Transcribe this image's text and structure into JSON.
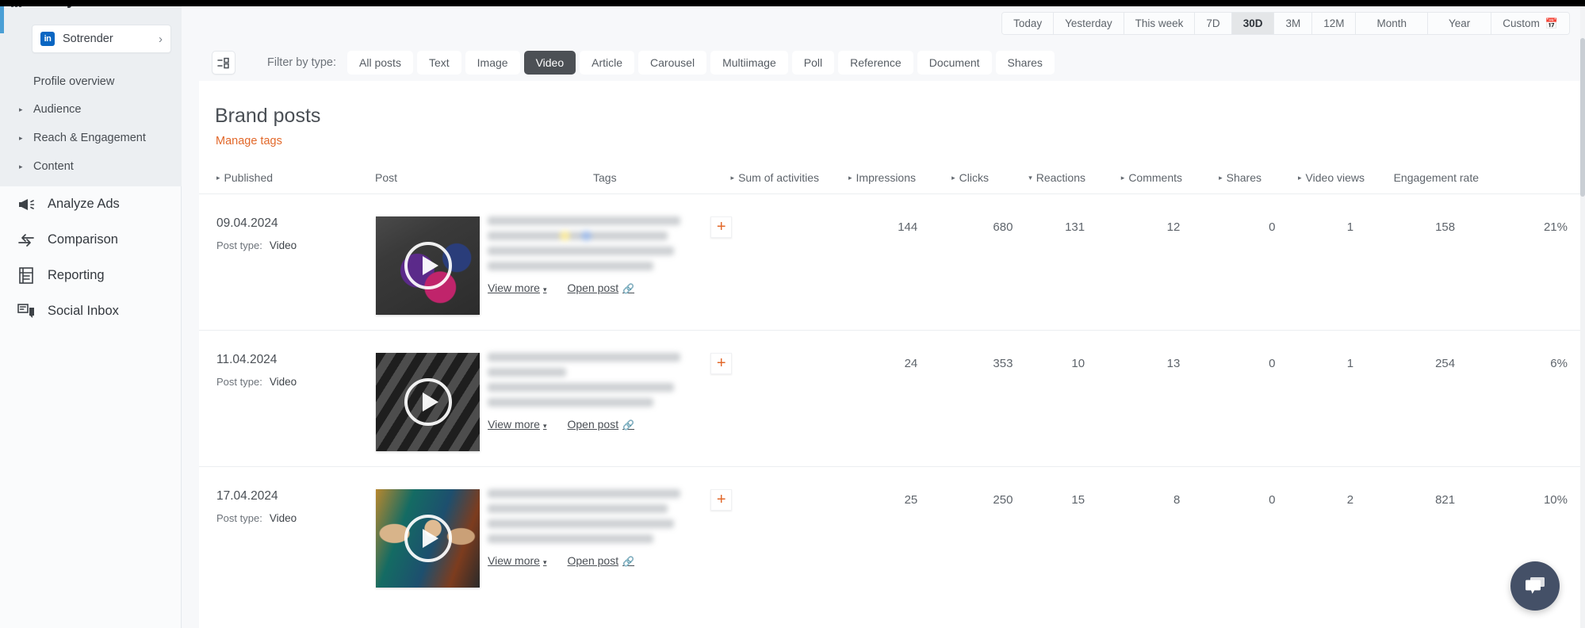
{
  "sidebar": {
    "section_title": "Analytics",
    "section_icon": "bar-chart-icon",
    "profile": {
      "network_badge": "in",
      "name": "Sotrender",
      "chevron": "›"
    },
    "sub_items": [
      {
        "label": "Profile overview",
        "expandable": false
      },
      {
        "label": "Audience",
        "expandable": true
      },
      {
        "label": "Reach & Engagement",
        "expandable": true
      },
      {
        "label": "Content",
        "expandable": true
      }
    ],
    "main_items": [
      {
        "label": "Analyze Ads",
        "icon": "megaphone-icon"
      },
      {
        "label": "Comparison",
        "icon": "compare-arrows-icon"
      },
      {
        "label": "Reporting",
        "icon": "document-report-icon"
      },
      {
        "label": "Social Inbox",
        "icon": "chat-inbox-icon"
      }
    ]
  },
  "date_range": {
    "options": [
      "Today",
      "Yesterday",
      "This week",
      "7D",
      "30D",
      "3M",
      "12M",
      "Month",
      "Year",
      "Custom"
    ],
    "selected": "30D",
    "custom_icon": "calendar-icon"
  },
  "filter": {
    "toggle_icon": "filter-list-icon",
    "label": "Filter by type:",
    "types": [
      "All posts",
      "Text",
      "Image",
      "Video",
      "Article",
      "Carousel",
      "Multiimage",
      "Poll",
      "Reference",
      "Document",
      "Shares"
    ],
    "selected": "Video"
  },
  "page": {
    "title": "Brand posts",
    "manage_tags_label": "Manage tags"
  },
  "table": {
    "columns": [
      {
        "key": "published",
        "label": "Published",
        "sort": "collapsed"
      },
      {
        "key": "post",
        "label": "Post",
        "sort": "none"
      },
      {
        "key": "tags",
        "label": "Tags",
        "sort": "none"
      },
      {
        "key": "sum",
        "label": "Sum of activities",
        "sort": "collapsed"
      },
      {
        "key": "impressions",
        "label": "Impressions",
        "sort": "collapsed"
      },
      {
        "key": "clicks",
        "label": "Clicks",
        "sort": "collapsed"
      },
      {
        "key": "reactions",
        "label": "Reactions",
        "sort": "expanded"
      },
      {
        "key": "comments",
        "label": "Comments",
        "sort": "collapsed"
      },
      {
        "key": "shares",
        "label": "Shares",
        "sort": "collapsed"
      },
      {
        "key": "video_views",
        "label": "Video views",
        "sort": "collapsed"
      },
      {
        "key": "engagement",
        "label": "Engagement rate",
        "sort": "none"
      }
    ],
    "post_type_label": "Post type:",
    "view_more_label": "View more",
    "open_post_label": "Open post",
    "add_tag_label": "+",
    "rows": [
      {
        "published": "09.04.2024",
        "post_type": "Video",
        "thumbnail": "phone-apps-photo",
        "post_text_redacted": true,
        "sum": "144",
        "impressions": "680",
        "clicks": "131",
        "reactions": "12",
        "comments": "0",
        "shares": "1",
        "video_views": "158",
        "engagement": "21%"
      },
      {
        "published": "11.04.2024",
        "post_type": "Video",
        "thumbnail": "striped-dark-photo",
        "post_text_redacted": true,
        "sum": "24",
        "impressions": "353",
        "clicks": "10",
        "reactions": "13",
        "comments": "0",
        "shares": "1",
        "video_views": "254",
        "engagement": "6%"
      },
      {
        "published": "17.04.2024",
        "post_type": "Video",
        "thumbnail": "people-mural-photo",
        "post_text_redacted": true,
        "sum": "25",
        "impressions": "250",
        "clicks": "15",
        "reactions": "8",
        "comments": "0",
        "shares": "2",
        "video_views": "821",
        "engagement": "10%"
      }
    ]
  },
  "chat_widget": {
    "icon": "chat-bubbles-icon"
  },
  "colors": {
    "accent_orange": "#e2682a",
    "linkedin_blue": "#0a66c2",
    "active_pill": "#4c5055",
    "sidebar_accent": "#4b9fd5",
    "chat_fab": "#445067"
  }
}
